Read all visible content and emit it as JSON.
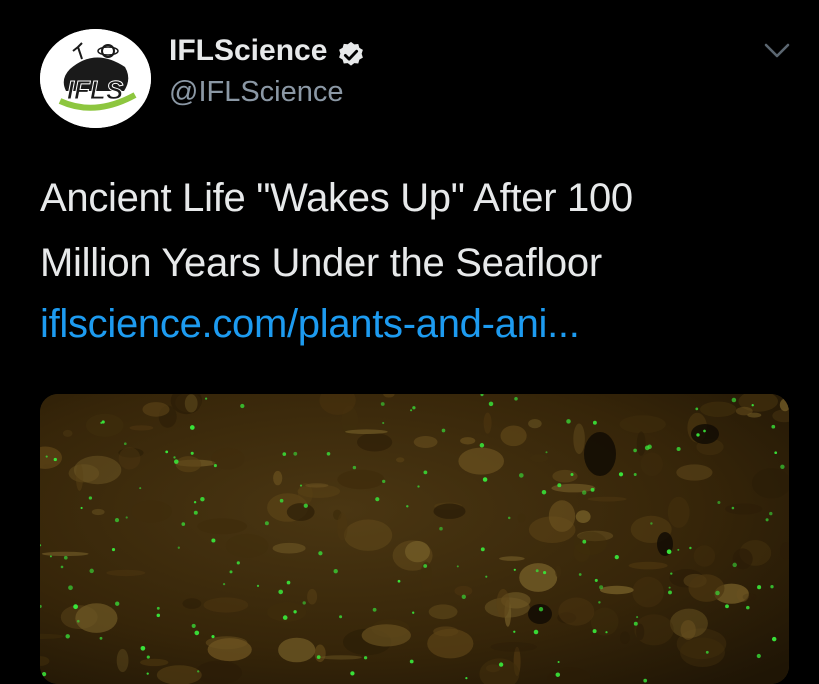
{
  "author": {
    "display_name": "IFLScience",
    "handle": "@IFLScience",
    "verified": true,
    "avatar_text": "IFLS"
  },
  "tweet": {
    "text_lines": [
      "Ancient Life \"Wakes Up\" After 100",
      "Million Years Under the Seafloor"
    ],
    "link_text": "iflscience.com/plants-and-ani..."
  },
  "icons": {
    "verified": "verified-badge-icon",
    "menu": "chevron-down-icon"
  },
  "colors": {
    "background": "#000000",
    "link": "#1d9bf0",
    "secondary_text": "#8b98a5",
    "media_green": "#39e63a"
  }
}
